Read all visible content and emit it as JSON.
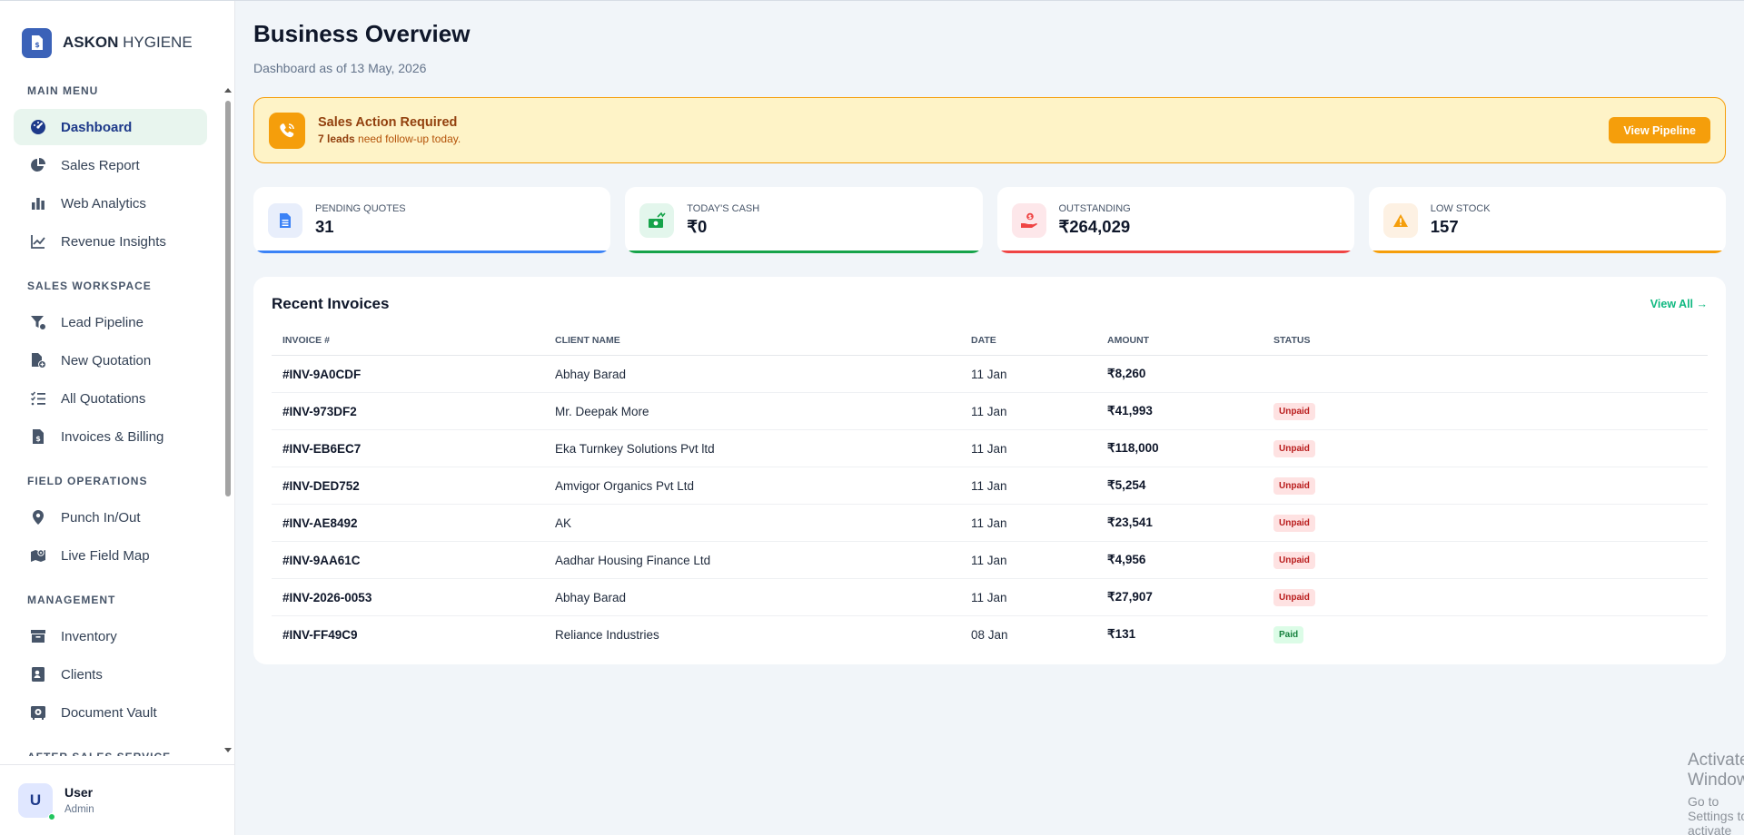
{
  "brand": {
    "name_bold": "ASKON",
    "name_light": "HYGIENE"
  },
  "sidebar": {
    "sections": [
      {
        "title": "MAIN MENU",
        "items": [
          {
            "label": "Dashboard",
            "icon": "dashboard-gauge-icon",
            "active": true
          },
          {
            "label": "Sales Report",
            "icon": "pie-chart-icon"
          },
          {
            "label": "Web Analytics",
            "icon": "bar-chart-icon"
          },
          {
            "label": "Revenue Insights",
            "icon": "line-chart-icon"
          }
        ]
      },
      {
        "title": "SALES WORKSPACE",
        "items": [
          {
            "label": "Lead Pipeline",
            "icon": "funnel-icon"
          },
          {
            "label": "New Quotation",
            "icon": "file-plus-icon"
          },
          {
            "label": "All Quotations",
            "icon": "list-check-icon"
          },
          {
            "label": "Invoices & Billing",
            "icon": "invoice-dollar-icon"
          }
        ]
      },
      {
        "title": "FIELD OPERATIONS",
        "items": [
          {
            "label": "Punch In/Out",
            "icon": "map-pin-icon"
          },
          {
            "label": "Live Field Map",
            "icon": "map-location-icon"
          }
        ]
      },
      {
        "title": "MANAGEMENT",
        "items": [
          {
            "label": "Inventory",
            "icon": "archive-box-icon"
          },
          {
            "label": "Clients",
            "icon": "contact-card-icon"
          },
          {
            "label": "Document Vault",
            "icon": "vault-icon"
          }
        ]
      },
      {
        "title": "AFTER SALES SERVICE",
        "items": []
      }
    ]
  },
  "user": {
    "initial": "U",
    "name": "User",
    "role": "Admin"
  },
  "header": {
    "title": "Business Overview",
    "subtitle": "Dashboard as of 13 May, 2026"
  },
  "alert": {
    "title": "Sales Action Required",
    "count_text": "7 leads",
    "rest_text": " need follow-up today.",
    "button": "View Pipeline"
  },
  "stats": [
    {
      "label": "PENDING QUOTES",
      "value": "31",
      "color": "#3b82f6",
      "bg": "#e8eefb",
      "icon": "file-text-icon"
    },
    {
      "label": "TODAY'S CASH",
      "value": "₹0",
      "color": "#16a34a",
      "bg": "#e3f6ec",
      "icon": "cash-icon"
    },
    {
      "label": "OUTSTANDING",
      "value": "₹264,029",
      "color": "#ef4444",
      "bg": "#fde7ea",
      "icon": "hand-money-icon"
    },
    {
      "label": "LOW STOCK",
      "value": "157",
      "color": "#f59e0b",
      "bg": "#fdf1e3",
      "icon": "warning-triangle-icon"
    }
  ],
  "invoices": {
    "title": "Recent Invoices",
    "view_all": "View All →",
    "columns": [
      "INVOICE #",
      "CLIENT NAME",
      "DATE",
      "AMOUNT",
      "STATUS"
    ],
    "rows": [
      {
        "id": "#INV-9A0CDF",
        "client": "Abhay Barad",
        "date": "11 Jan",
        "amount": "₹8,260",
        "status": ""
      },
      {
        "id": "#INV-973DF2",
        "client": "Mr. Deepak More",
        "date": "11 Jan",
        "amount": "₹41,993",
        "status": "Unpaid"
      },
      {
        "id": "#INV-EB6EC7",
        "client": "Eka Turnkey Solutions Pvt ltd",
        "date": "11 Jan",
        "amount": "₹118,000",
        "status": "Unpaid"
      },
      {
        "id": "#INV-DED752",
        "client": "Amvigor Organics Pvt Ltd",
        "date": "11 Jan",
        "amount": "₹5,254",
        "status": "Unpaid"
      },
      {
        "id": "#INV-AE8492",
        "client": "AK",
        "date": "11 Jan",
        "amount": "₹23,541",
        "status": "Unpaid"
      },
      {
        "id": "#INV-9AA61C",
        "client": "Aadhar Housing Finance Ltd",
        "date": "11 Jan",
        "amount": "₹4,956",
        "status": "Unpaid"
      },
      {
        "id": "#INV-2026-0053",
        "client": "Abhay Barad",
        "date": "11 Jan",
        "amount": "₹27,907",
        "status": "Unpaid"
      },
      {
        "id": "#INV-FF49C9",
        "client": "Reliance Industries",
        "date": "08 Jan",
        "amount": "₹131",
        "status": "Paid"
      }
    ]
  },
  "watermark": {
    "title": "Activate Windows",
    "subtitle": "Go to Settings to activate Windows."
  }
}
